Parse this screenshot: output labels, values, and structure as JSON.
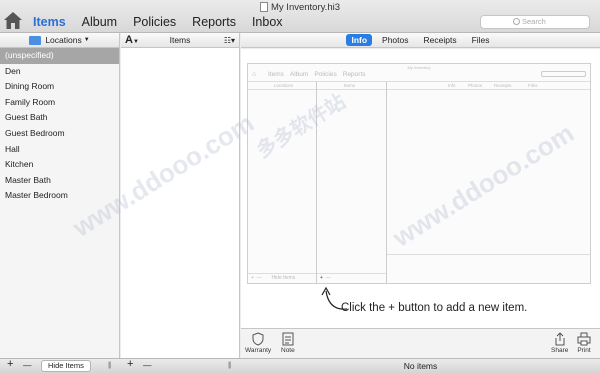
{
  "window": {
    "title": "My Inventory.hi3"
  },
  "nav": {
    "tabs": [
      "Items",
      "Album",
      "Policies",
      "Reports",
      "Inbox"
    ],
    "active": "Items"
  },
  "search": {
    "placeholder": "Search"
  },
  "locations": {
    "header": "Locations",
    "items": [
      "(unspecified)",
      "Den",
      "Dining Room",
      "Family Room",
      "Guest Bath",
      "Guest Bedroom",
      "Hall",
      "Kitchen",
      "Master Bath",
      "Master Bedroom"
    ],
    "selected_index": 0
  },
  "items_column": {
    "sort_label": "A",
    "header": "Items"
  },
  "detail_tabs": {
    "tabs": [
      "Info",
      "Photos",
      "Receipts",
      "Files"
    ],
    "active": "Info"
  },
  "mini_preview": {
    "title": "My Inventory",
    "nav": [
      "Items",
      "Album",
      "Policies",
      "Reports"
    ],
    "columns": [
      "Locations",
      "Items",
      "Info",
      "Photos",
      "Receipts",
      "Files"
    ],
    "footer_hide": "Hide Items"
  },
  "callout": {
    "text": "Click the + button to add a new item."
  },
  "detail_tools": {
    "warranty": "Warranty",
    "note": "Note",
    "share": "Share",
    "print": "Print"
  },
  "bottom_bar": {
    "plus": "+",
    "minus": "—",
    "hide_items": "Hide Items",
    "status": "No items"
  },
  "watermark": {
    "text": "www.ddooo.com",
    "cn": "多多软件站"
  },
  "colors": {
    "accent": "#2a7de1",
    "selection": "#a6a6a6"
  }
}
